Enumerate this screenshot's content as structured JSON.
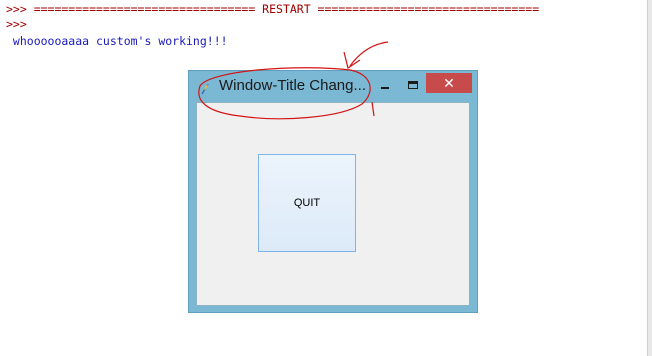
{
  "shell": {
    "restart_line": ">>> ================================ RESTART ================================",
    "prompt_line": ">>>",
    "output_line": " whoooooaaaa custom's working!!!",
    "output_color": "#1a1ab8",
    "prompt_color": "#a00000"
  },
  "window": {
    "title": "Window-Title Chang...",
    "app_icon": "python-feather-icon",
    "minimize_icon": "minimize-icon",
    "maximize_icon": "maximize-icon",
    "close_label": "✕",
    "title_bar_color": "#7bb8d3",
    "close_color": "#c84b4b",
    "quit_button": {
      "label": "QUIT"
    }
  },
  "annotation": {
    "color": "#d31414"
  }
}
